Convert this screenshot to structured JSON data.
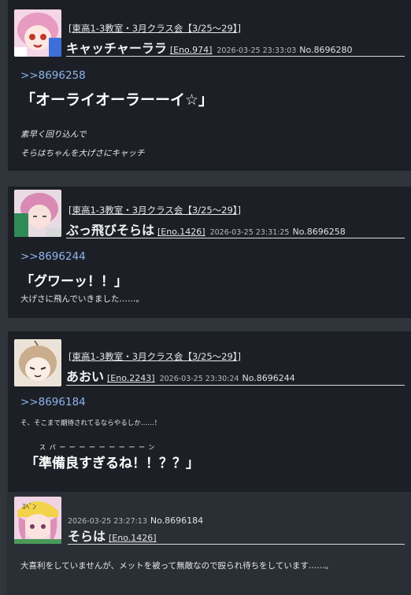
{
  "posts": [
    {
      "room": "[東高1-3教室・3月クラス会【3/25〜29】]",
      "name": "キャッチャーララ",
      "eno": "[Eno.974]",
      "timestamp": "2026-03-25 23:33:03",
      "post_no": "No.8696280",
      "reply_to": ">>8696258",
      "big_text": "「オーライオーラーーイ☆」",
      "lines": [
        "素早く回り込んで",
        "そらはちゃんを大げさにキャッチ"
      ]
    },
    {
      "room": "[東高1-3教室・3月クラス会【3/25〜29】]",
      "name": "ぶっ飛びそらは",
      "eno": "[Eno.1426]",
      "timestamp": "2026-03-25 23:31:25",
      "post_no": "No.8696258",
      "reply_to": ">>8696244",
      "big_text": "「グワーッ！！」",
      "lines": [
        "大げさに飛んでいきました……。"
      ]
    },
    {
      "room": "[東高1-3教室・3月クラス会【3/25〜29】]",
      "name": "あおい",
      "eno": "[Eno.2243]",
      "timestamp": "2026-03-25 23:30:24",
      "post_no": "No.8696244",
      "reply_to": ">>8696184",
      "small_line": "そ、そこまで期待されてるならやるしか……！",
      "ruby": "スパーーーーーーーーーン",
      "big_text": "「準備良すぎるね！！？？」"
    },
    {
      "timestamp": "2026-03-25 23:27:13",
      "post_no": "No.8696184",
      "name": "そらは",
      "eno": "[Eno.1426]",
      "lines": [
        "大喜利をしていませんが、メットを被って無敵なので殴られ待ちをしています……。"
      ]
    }
  ],
  "colors": {
    "background": "#2f353b",
    "card": "#1c2026",
    "reply_card": "#2a2f36",
    "link": "#8fb4ec"
  }
}
